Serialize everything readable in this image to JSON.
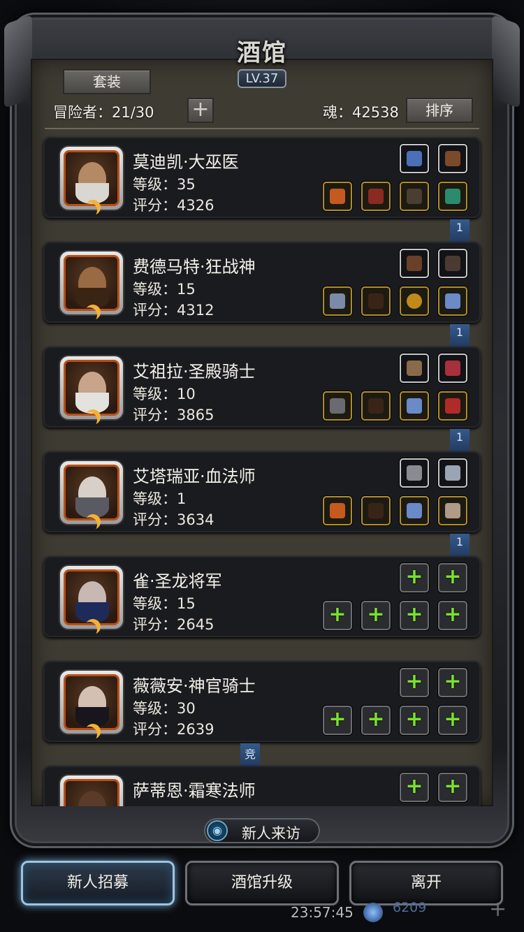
{
  "header": {
    "title": "酒馆",
    "level": "LV.37",
    "set_button": "套装",
    "adventurers": "冒险者：21/30",
    "add_button": "+",
    "souls": "魂：42538",
    "sort_button": "排序"
  },
  "heroes": [
    {
      "name": "莫迪凯·大巫医",
      "level": "等级：35",
      "score": "评分：4326",
      "ribbon": "1"
    },
    {
      "name": "费德马特·狂战神",
      "level": "等级：15",
      "score": "评分：4312",
      "ribbon": "1"
    },
    {
      "name": "艾祖拉·圣殿骑士",
      "level": "等级：10",
      "score": "评分：3865",
      "ribbon": "1"
    },
    {
      "name": "艾塔瑞亚·血法师",
      "level": "等级：1",
      "score": "评分：3634",
      "ribbon": "1"
    },
    {
      "name": "雀·圣龙将军",
      "level": "等级：15",
      "score": "评分：2645"
    },
    {
      "name": "薇薇安·神官骑士",
      "level": "等级：30",
      "score": "评分：2639",
      "ribbon": "竞"
    },
    {
      "name": "萨蒂恩·霜寒法师"
    }
  ],
  "visitor": {
    "label": "新人来访"
  },
  "buttons": {
    "recruit": "新人招募",
    "upgrade": "酒馆升级",
    "leave": "离开"
  },
  "hud": {
    "clock": "23:57:45",
    "gems": "6209"
  },
  "colors": {
    "empty_slot_plus": "#7ae02e",
    "ribbon": "#355a8c",
    "portrait_border": "#b94f14"
  }
}
